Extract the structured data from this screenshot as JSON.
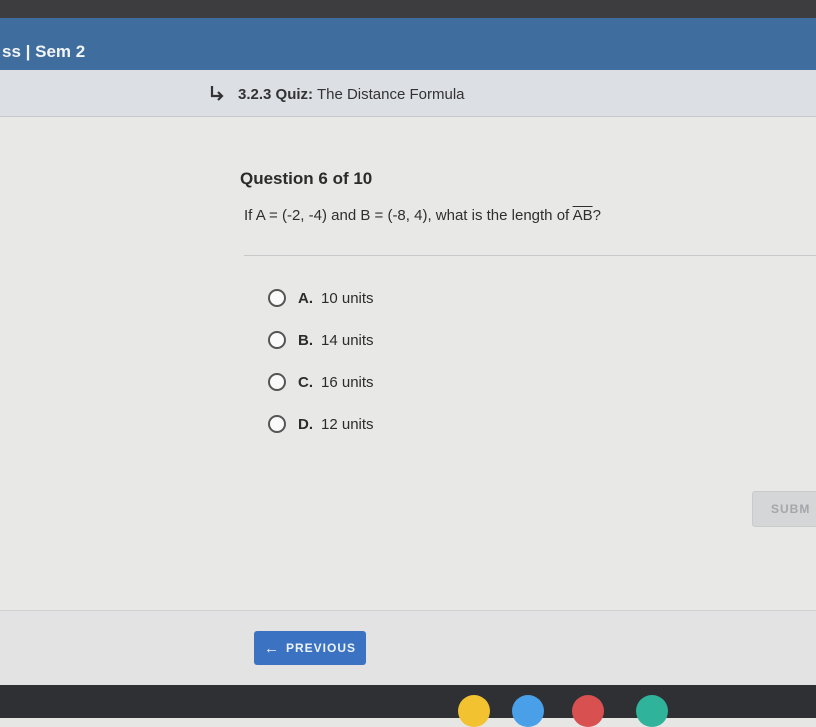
{
  "course": {
    "title": "ss | Sem 2"
  },
  "quiz": {
    "number": "3.2.3",
    "label": "Quiz:",
    "title": "The Distance Formula"
  },
  "question": {
    "counter": "Question 6 of 10",
    "prefix": "If",
    "pointA": "A = (-2, -4)",
    "and": "and",
    "pointB": "B = (-8, 4)",
    "suffix": ", what is the length of",
    "segment": "AB",
    "end": "?"
  },
  "options": [
    {
      "letter": "A.",
      "text": "10 units"
    },
    {
      "letter": "B.",
      "text": "14 units"
    },
    {
      "letter": "C.",
      "text": "16 units"
    },
    {
      "letter": "D.",
      "text": "12 units"
    }
  ],
  "submit": {
    "label": "SUBM"
  },
  "nav": {
    "previous_label": "PREVIOUS",
    "previous_arrow": "←"
  },
  "taskbar": {
    "icons": [
      {
        "name": "chrome-icon",
        "color": "#f2c230"
      },
      {
        "name": "app-icon",
        "color": "#4aa0e8"
      },
      {
        "name": "media-icon",
        "color": "#d85050"
      },
      {
        "name": "play-icon",
        "color": "#2fb39a"
      }
    ]
  }
}
